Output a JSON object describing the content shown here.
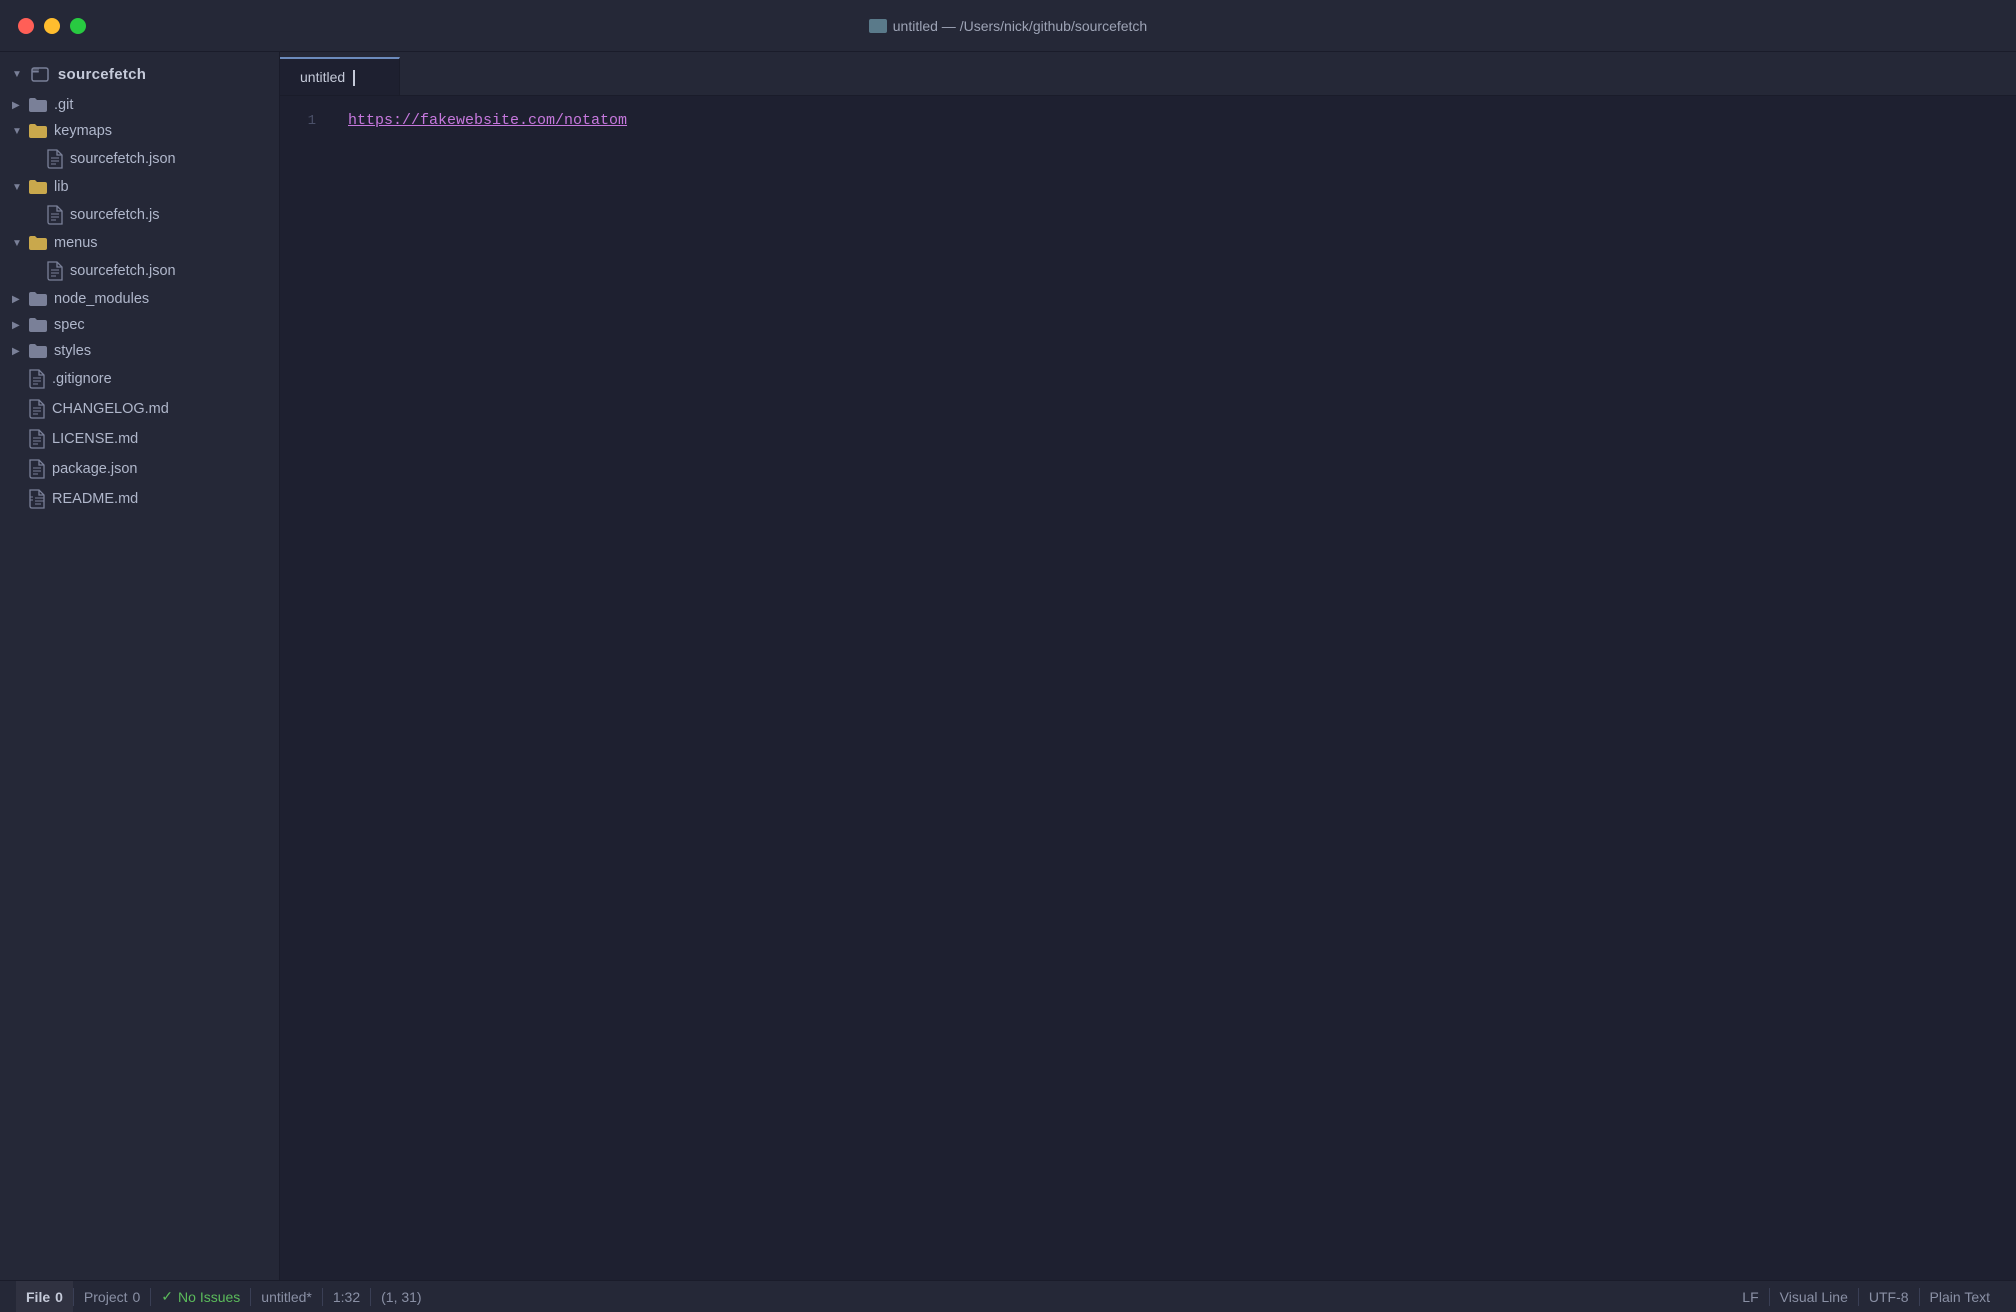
{
  "titlebar": {
    "title": "untitled — /Users/nick/github/sourcefetch",
    "controls": {
      "close": "close",
      "minimize": "minimize",
      "maximize": "maximize"
    }
  },
  "sidebar": {
    "project_name": "sourcefetch",
    "items": [
      {
        "id": "git",
        "label": ".git",
        "type": "folder",
        "depth": 0,
        "expanded": false
      },
      {
        "id": "keymaps",
        "label": "keymaps",
        "type": "folder",
        "depth": 0,
        "expanded": true
      },
      {
        "id": "sourcefetch-json-keymaps",
        "label": "sourcefetch.json",
        "type": "file",
        "depth": 1
      },
      {
        "id": "lib",
        "label": "lib",
        "type": "folder",
        "depth": 0,
        "expanded": true
      },
      {
        "id": "sourcefetch-js",
        "label": "sourcefetch.js",
        "type": "file",
        "depth": 1
      },
      {
        "id": "menus",
        "label": "menus",
        "type": "folder",
        "depth": 0,
        "expanded": true
      },
      {
        "id": "sourcefetch-json-menus",
        "label": "sourcefetch.json",
        "type": "file",
        "depth": 1
      },
      {
        "id": "node_modules",
        "label": "node_modules",
        "type": "folder",
        "depth": 0,
        "expanded": false
      },
      {
        "id": "spec",
        "label": "spec",
        "type": "folder",
        "depth": 0,
        "expanded": false
      },
      {
        "id": "styles",
        "label": "styles",
        "type": "folder",
        "depth": 0,
        "expanded": false
      },
      {
        "id": "gitignore",
        "label": ".gitignore",
        "type": "file",
        "depth": 0
      },
      {
        "id": "changelog",
        "label": "CHANGELOG.md",
        "type": "file",
        "depth": 0
      },
      {
        "id": "license",
        "label": "LICENSE.md",
        "type": "file",
        "depth": 0
      },
      {
        "id": "package",
        "label": "package.json",
        "type": "file",
        "depth": 0
      },
      {
        "id": "readme",
        "label": "README.md",
        "type": "file-book",
        "depth": 0
      }
    ]
  },
  "tabs": [
    {
      "id": "untitled",
      "label": "untitled",
      "active": true
    }
  ],
  "editor": {
    "lines": [
      {
        "number": "1",
        "content": "https://fakewebsite.com/notatom",
        "type": "url"
      }
    ]
  },
  "statusbar": {
    "file_label": "File",
    "file_count": "0",
    "project_label": "Project",
    "project_count": "0",
    "no_issues_label": "No Issues",
    "filename": "untitled*",
    "cursor_pos": "1:32",
    "line_col": "(1, 31)",
    "line_ending": "LF",
    "visual_mode": "Visual Line",
    "encoding": "UTF-8",
    "syntax": "Plain Text"
  }
}
